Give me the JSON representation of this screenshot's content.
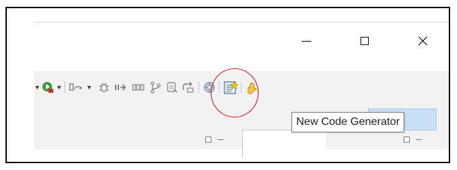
{
  "window_controls": {
    "minimize_icon": "minimize-icon",
    "maximize_icon": "maximize-icon",
    "close_icon": "close-icon"
  },
  "toolbar": {
    "items": [
      {
        "name": "dropdown-arrow-icon"
      },
      {
        "name": "run-icon"
      },
      {
        "name": "dropdown-arrow-icon"
      },
      {
        "name": "open-type-icon"
      },
      {
        "name": "dropdown-arrow-icon"
      },
      {
        "name": "debug-icon"
      },
      {
        "name": "step-into-icon"
      },
      {
        "name": "use-step-filters-icon"
      },
      {
        "name": "git-icon"
      },
      {
        "name": "open-resource-icon"
      },
      {
        "name": "refresh-icon"
      },
      {
        "name": "generator-icon"
      },
      {
        "name": "new-code-generator-icon"
      },
      {
        "name": "quick-action-icon"
      }
    ],
    "highlight_color": "#e00000"
  },
  "tooltip": {
    "text": "New Code Generator"
  }
}
